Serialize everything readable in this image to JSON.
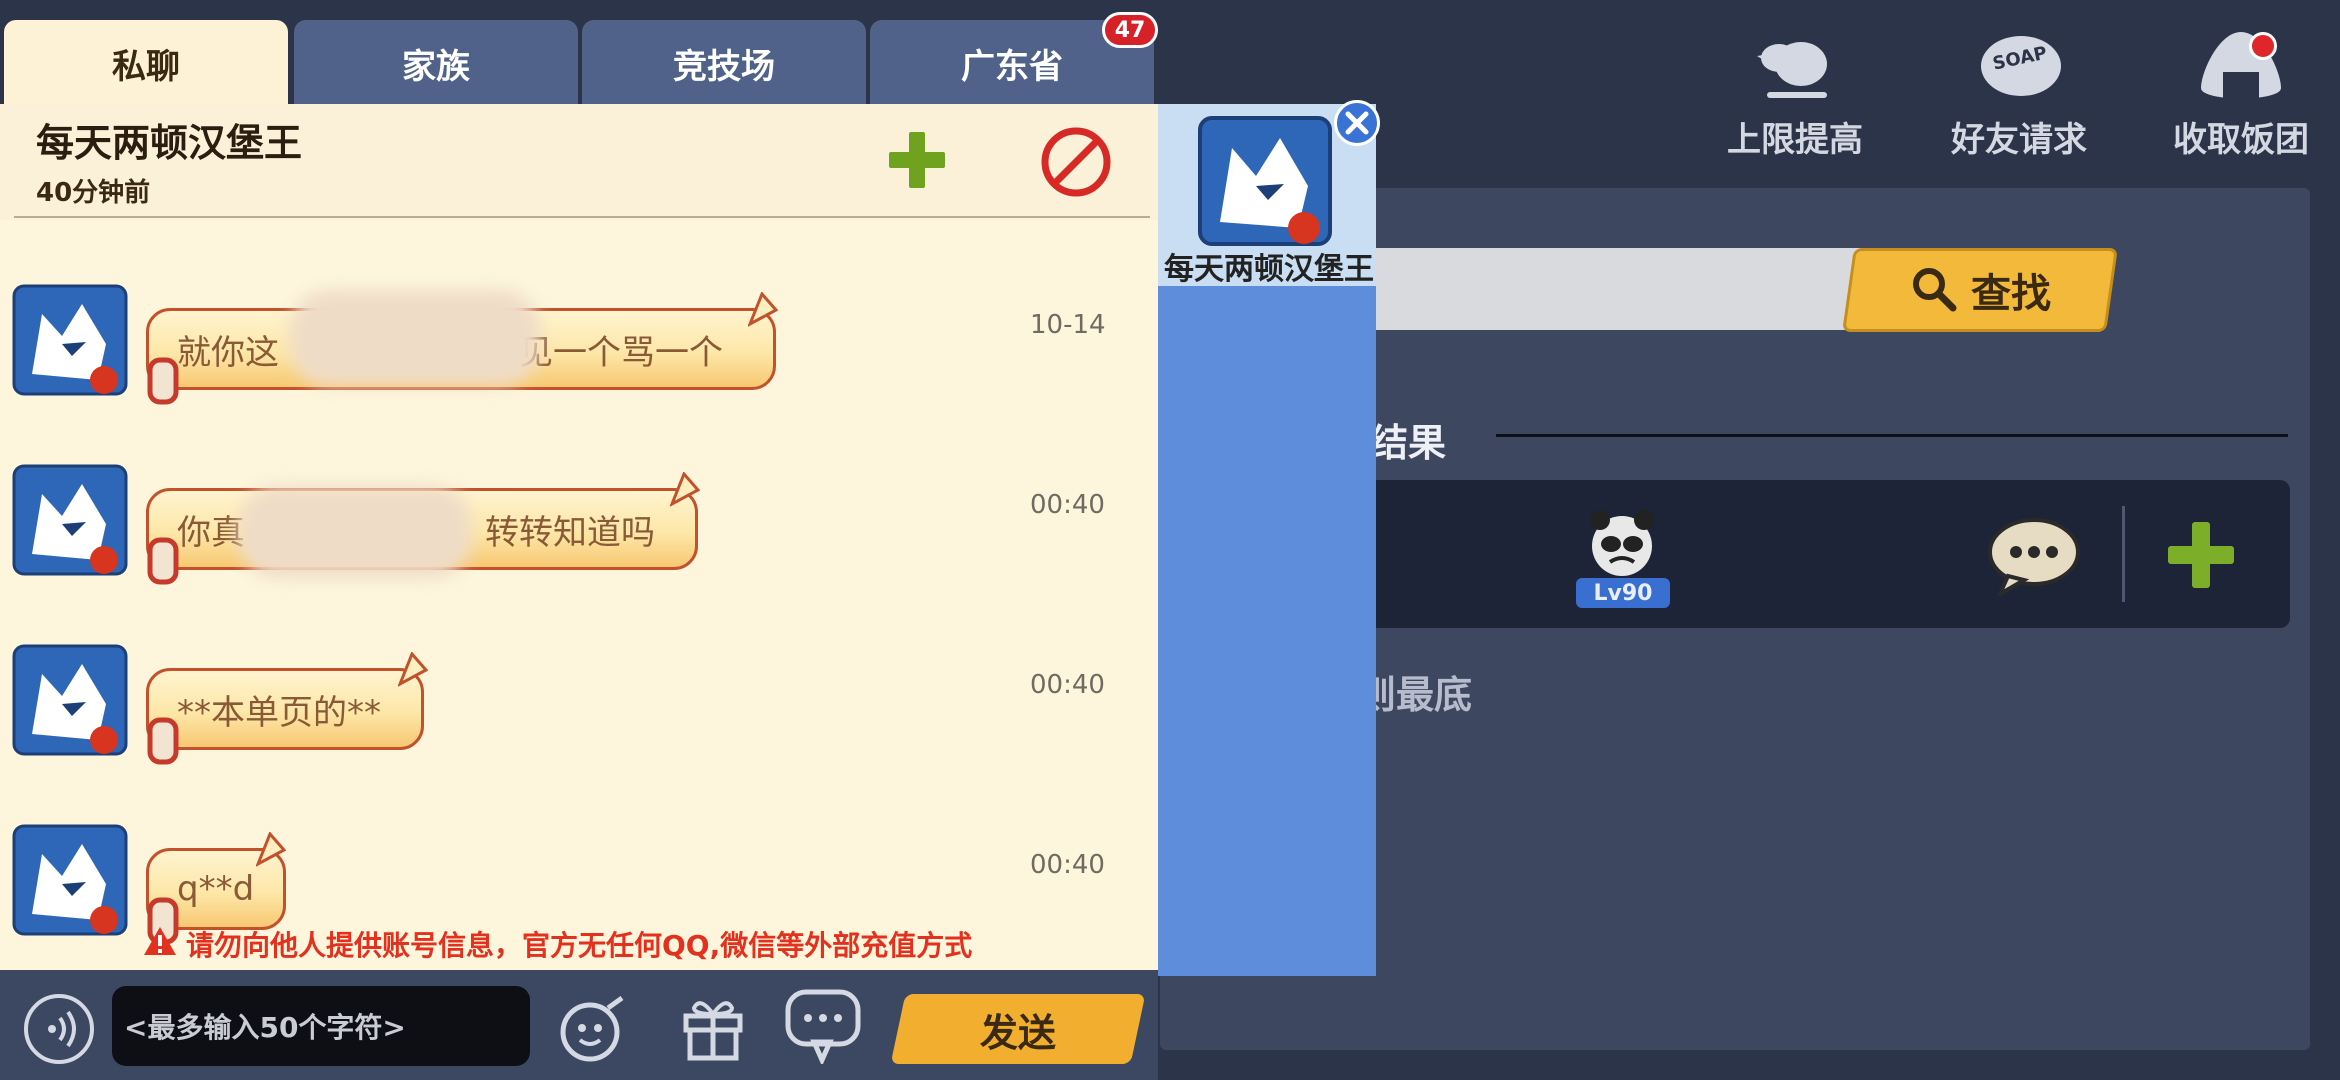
{
  "tabs": [
    {
      "label": "私聊"
    },
    {
      "label": "家族"
    },
    {
      "label": "竞技场"
    },
    {
      "label": "广东省"
    }
  ],
  "tab_badge": "47",
  "chat_header": {
    "name": "每天两顿汉堡王",
    "time": "40分钟前"
  },
  "messages": [
    {
      "text_start": "就你这",
      "text_end": "见一个骂一个",
      "time": "10-14"
    },
    {
      "text_start": "你真",
      "text_end": "转转知道吗",
      "time": "00:40"
    },
    {
      "text": "**本单页的**",
      "time": "00:40"
    },
    {
      "text": "q**d",
      "time": "00:40"
    }
  ],
  "warning": "请勿向他人提供账号信息，官方无任何QQ,微信等外部充值方式",
  "input_placeholder": "<最多输入50个字符>",
  "send_label": "发送",
  "popup": {
    "name": "每天两顿汉堡王"
  },
  "top_buttons": [
    {
      "label": "上限提高"
    },
    {
      "label": "好友请求"
    },
    {
      "label": "收取饭团"
    }
  ],
  "search": {
    "button_label": "查找"
  },
  "results": {
    "title": "结果",
    "level": "Lv90",
    "bottom_text": "则最底"
  },
  "colors": {
    "accent_yellow": "#f3b93b",
    "panel_dark": "#2c3449",
    "warning_red": "#e3311f",
    "popup_blue": "#5e8edb"
  }
}
